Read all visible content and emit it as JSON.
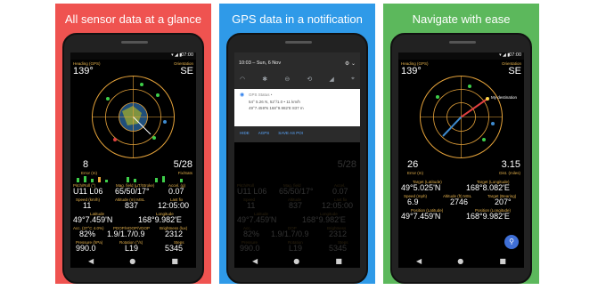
{
  "panels": [
    {
      "caption": "All sensor data at a glance",
      "status_time": "07:00",
      "top_left_label": "Heading (GPS)",
      "top_right_label": "Orientation",
      "heading": "139°",
      "orientation": "SE",
      "mid_left_value": "8",
      "mid_left_label": "Error (m)",
      "mid_right_value": "5/28",
      "mid_right_label": "Fix/Sats",
      "rows": [
        {
          "label": "Pitch/Roll (°)",
          "value": "U11 L06"
        },
        {
          "label": "Mag. field (µT/Stroke)",
          "value": "65/50/17°"
        },
        {
          "label": "Accel. (g)",
          "value": "0.07"
        },
        {
          "label": "Speed (km/h)",
          "value": "11"
        },
        {
          "label": "Altitude (m) MSL",
          "value": "837"
        },
        {
          "label": "Last fix",
          "value": "12:05:00"
        },
        {
          "label": "Latitude",
          "value": "49°7.459'N"
        },
        {
          "label": "Longitude",
          "value": "168°9.982'E"
        },
        {
          "label": "Acc. (37°C 4.0%)",
          "value": "82%"
        },
        {
          "label": "PDOP/HDOP/VDOP",
          "value": "1.9/1.7/0.9"
        },
        {
          "label": "Brightness (lux)",
          "value": "2312"
        },
        {
          "label": "Pressure (hPa)",
          "value": "990.0"
        },
        {
          "label": "Rotation (°/s)",
          "value": "L19"
        },
        {
          "label": "Steps",
          "value": "5345"
        }
      ]
    },
    {
      "caption": "GPS data in a notification",
      "shade_time": "10:03 – Sun, 6 Nov",
      "notif_app": "GPS Status •",
      "notif_line1": "54° 5.26 N, 52°/1.0 • 11 km/h",
      "notif_line2": "49°7.459'N 168°9.982'E 837 m",
      "notif_actions": [
        "HIDE",
        "AGPS",
        "SAVE AS POI"
      ],
      "mid_right_value": "5/28",
      "rows": [
        {
          "label": "Pitch/Roll",
          "value": "U11 L06"
        },
        {
          "label": "Mag. field",
          "value": "65/50/17°"
        },
        {
          "label": "Accel.",
          "value": "0.07"
        },
        {
          "label": "Speed",
          "value": "11"
        },
        {
          "label": "Altitude",
          "value": "837"
        },
        {
          "label": "Last fix",
          "value": "12:05:00"
        },
        {
          "label": "Latitude",
          "value": "49°7.459'N"
        },
        {
          "label": "Longitude",
          "value": "168°9.982'E"
        },
        {
          "label": "Acc.",
          "value": "82%"
        },
        {
          "label": "DOP",
          "value": "1.9/1.7/0.9"
        },
        {
          "label": "Brightness",
          "value": "2312"
        },
        {
          "label": "Pressure",
          "value": "990.0"
        },
        {
          "label": "Rotation",
          "value": "L19"
        },
        {
          "label": "Steps",
          "value": "5345"
        }
      ]
    },
    {
      "caption": "Navigate with ease",
      "status_time": "07:00",
      "top_left_label": "Heading (GPS)",
      "top_right_label": "Orientation",
      "heading": "139°",
      "orientation": "SE",
      "destination_label": "My destination",
      "mid_left_value": "26",
      "mid_left_label": "Error (m)",
      "mid_right_value": "3.15",
      "mid_right_label": "Dist. (miles)",
      "rows": [
        {
          "label": "Target (Latitude)",
          "value": "49°5.025'N"
        },
        {
          "label": "Target (Longitude)",
          "value": "168°8.082'E"
        },
        {
          "label": "Speed (mph)",
          "value": "6.9"
        },
        {
          "label": "Altitude (ft) MSL",
          "value": "2746"
        },
        {
          "label": "Target (Bearing)",
          "value": "207°"
        },
        {
          "label": "Position (Latitude)",
          "value": "49°7.459'N"
        },
        {
          "label": "Position (Longitude)",
          "value": "168°9.982'E"
        }
      ]
    }
  ],
  "nav_glyphs": [
    "◀",
    "●",
    "■"
  ],
  "colors": {
    "red": "#ef5350",
    "blue": "#2f9ae8",
    "green": "#5cb85c",
    "label_gold": "#e3b04b"
  }
}
